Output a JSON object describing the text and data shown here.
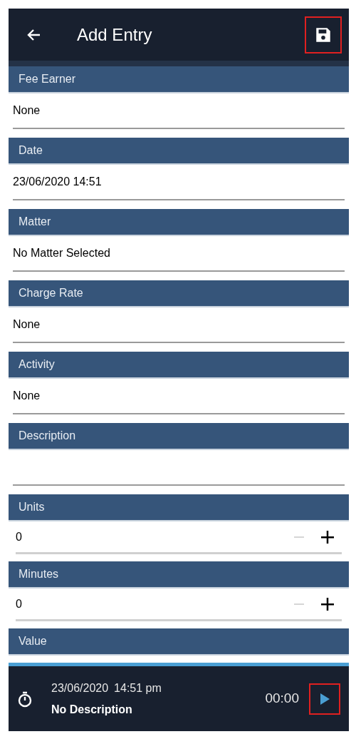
{
  "header": {
    "title": "Add Entry",
    "save_highlighted": true
  },
  "fields": [
    {
      "kind": "text",
      "label": "Fee Earner",
      "value": "None"
    },
    {
      "kind": "text",
      "label": "Date",
      "value": "23/06/2020 14:51"
    },
    {
      "kind": "text",
      "label": "Matter",
      "value": "No Matter Selected"
    },
    {
      "kind": "text",
      "label": "Charge Rate",
      "value": "None"
    },
    {
      "kind": "text",
      "label": "Activity",
      "value": "None"
    },
    {
      "kind": "text",
      "label": "Description"
    },
    {
      "kind": "stepper",
      "label": "Units",
      "value": "0",
      "minus_disabled": true,
      "plus_disabled": false
    },
    {
      "kind": "stepper",
      "label": "Minutes",
      "value": "0",
      "minus_disabled": true,
      "plus_disabled": false
    },
    {
      "kind": "heading",
      "label": "Value"
    }
  ],
  "timer": {
    "date": "23/06/2020",
    "time": "14:51 pm",
    "description": "No Description",
    "elapsed": "00:00",
    "play_highlighted": true
  }
}
